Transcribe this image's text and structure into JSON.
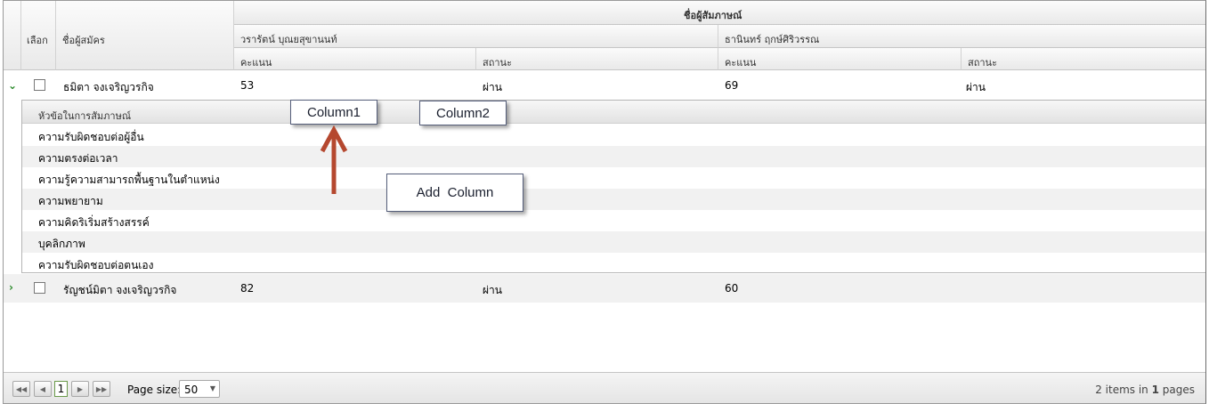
{
  "header": {
    "select_label": "เลือก",
    "applicant_name_label": "ชื่อผู้สมัคร",
    "interviewer_group_label": "ชื่อผู้สัมภาษณ์",
    "interviewers": [
      {
        "name": "วรารัตน์ บุณยสุขานนท์",
        "score_label": "คะแนน",
        "status_label": "สถานะ"
      },
      {
        "name": "ธานินทร์ ฤกษ์ศิริวรรณ",
        "score_label": "คะแนน",
        "status_label": "สถานะ"
      }
    ]
  },
  "rows": [
    {
      "expanded": true,
      "applicant": "ธมิตา จงเจริญวรกิจ",
      "score1": "53",
      "status1": "ผ่าน",
      "score2": "69",
      "status2": "ผ่าน"
    },
    {
      "expanded": false,
      "applicant": "รัญชน์มิตา จงเจริญวรกิจ",
      "score1": "82",
      "status1": "ผ่าน",
      "score2": "60",
      "status2": ""
    }
  ],
  "detail": {
    "header": "หัวข้อในการสัมภาษณ์",
    "topics": [
      "ความรับผิดชอบต่อผู้อื่น",
      "ความตรงต่อเวลา",
      "ความรู้ความสามารถพื้นฐานในตำแหน่ง",
      "ความพยายาม",
      "ความคิดริเริ่มสร้างสรรค์",
      "บุคลิกภาพ",
      "ความรับผิดชอบต่อตนเอง"
    ]
  },
  "callouts": {
    "column1": "Column1",
    "column2": "Column2",
    "add_column": "Add  Column",
    "arrow_color": "#b5482f"
  },
  "pager": {
    "current_page": "1",
    "page_size_label": "Page size:",
    "page_size_value": "50",
    "info_prefix": "2 items in ",
    "info_pages": "1",
    "info_suffix": " pages"
  }
}
